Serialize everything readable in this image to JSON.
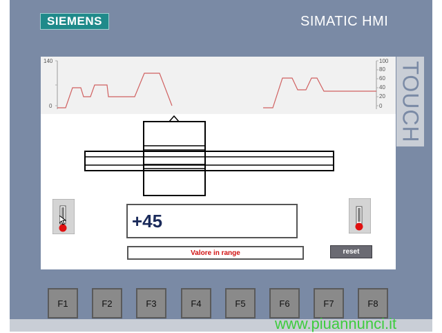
{
  "header": {
    "logo": "SIEMENS",
    "brand": "SIMATIC HMI",
    "touch_label": "TOUCH"
  },
  "trend": {
    "left_axis_ticks": [
      "140",
      "0"
    ],
    "right_axis_ticks": [
      "100",
      "80",
      "60",
      "40",
      "20",
      "0"
    ]
  },
  "value_display": "+45",
  "status_message": "Valore in range",
  "reset_label": "reset",
  "function_keys": [
    "F1",
    "F2",
    "F3",
    "F4",
    "F5",
    "F6",
    "F7",
    "F8"
  ],
  "watermark": "www.piuannunci.it",
  "colors": {
    "bezel": "#7a8aa5",
    "logo": "#1f8a8a",
    "trend_line": "#d06060",
    "status_text": "#d01010",
    "indicator": "#e01010"
  }
}
